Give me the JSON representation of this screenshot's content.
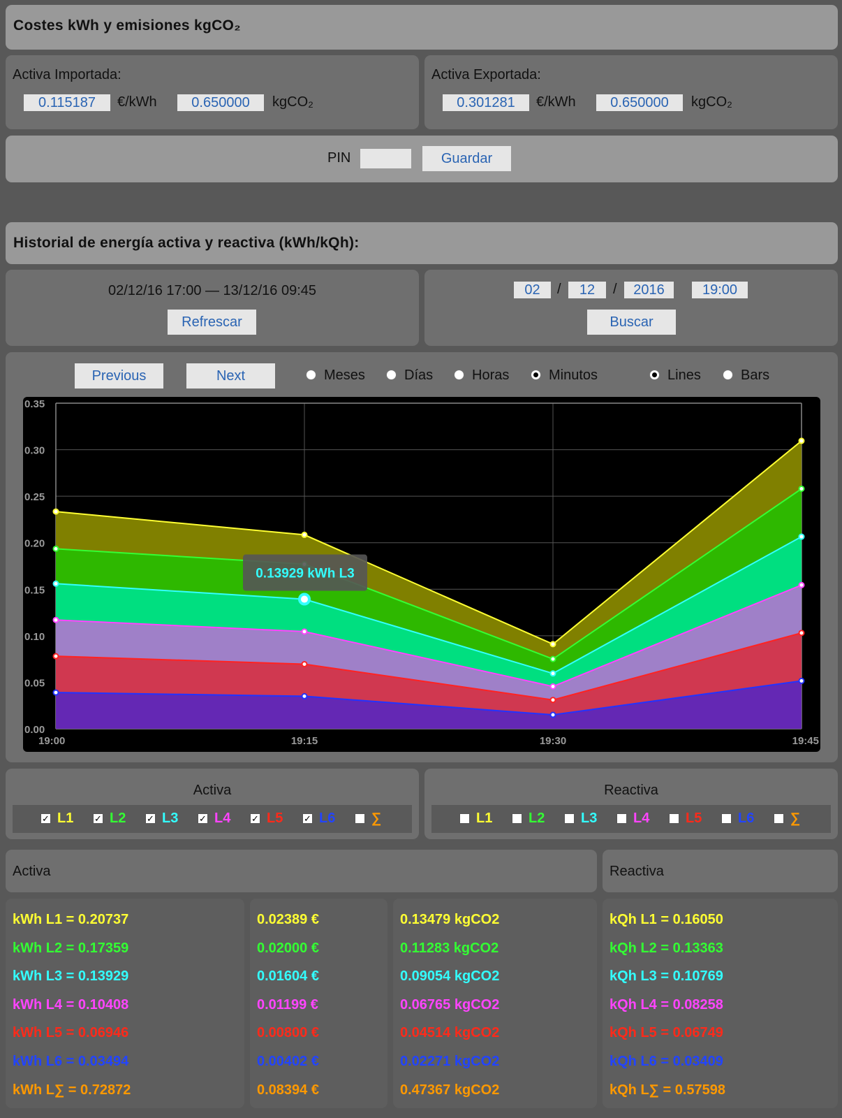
{
  "costs": {
    "title": "Costes kWh y emisiones kgCO₂",
    "import": {
      "label": "Activa Importada:",
      "price": "0.115187",
      "price_unit": "€/kWh",
      "co2": "0.650000",
      "co2_unit": "kgCO₂"
    },
    "export": {
      "label": "Activa Exportada:",
      "price": "0.301281",
      "price_unit": "€/kWh",
      "co2": "0.650000",
      "co2_unit": "kgCO₂"
    },
    "pin_label": "PIN",
    "pin_value": "",
    "save_label": "Guardar"
  },
  "history": {
    "title": "Historial de energía activa y reactiva (kWh/kQh):",
    "range": "02/12/16 17:00 — 13/12/16 09:45",
    "refresh_label": "Refrescar",
    "date": {
      "day": "02",
      "month": "12",
      "year": "2016",
      "time": "19:00",
      "sep": "/"
    },
    "search_label": "Buscar"
  },
  "controls": {
    "previous_label": "Previous",
    "next_label": "Next",
    "periods": [
      {
        "label": "Meses",
        "selected": false
      },
      {
        "label": "Días",
        "selected": false
      },
      {
        "label": "Horas",
        "selected": false
      },
      {
        "label": "Minutos",
        "selected": true
      }
    ],
    "modes": [
      {
        "label": "Lines",
        "selected": true
      },
      {
        "label": "Bars",
        "selected": false
      }
    ]
  },
  "chart_data": {
    "type": "area",
    "x": [
      "19:00",
      "19:15",
      "19:30",
      "19:45"
    ],
    "ylim": [
      0,
      0.35
    ],
    "yticks": [
      "0.00",
      "0.05",
      "0.10",
      "0.15",
      "0.20",
      "0.25",
      "0.30",
      "0.35"
    ],
    "grid": true,
    "stacked": true,
    "series": [
      {
        "name": "L1",
        "color": "#ffff33",
        "fill": "#808000",
        "cumulative": [
          0.2335,
          0.2085,
          0.091,
          0.3095
        ]
      },
      {
        "name": "L2",
        "color": "#33ff33",
        "fill": "#2eb800",
        "cumulative": [
          0.1935,
          0.177,
          0.075,
          0.258
        ]
      },
      {
        "name": "L3",
        "color": "#33ffff",
        "fill": "#00df80",
        "cumulative": [
          0.156,
          0.1393,
          0.0595,
          0.2065
        ]
      },
      {
        "name": "L4",
        "color": "#ff44ff",
        "fill": "#9f80c8",
        "cumulative": [
          0.117,
          0.1045,
          0.0455,
          0.1545
        ]
      },
      {
        "name": "L5",
        "color": "#ff2222",
        "fill": "#d03850",
        "cumulative": [
          0.078,
          0.0695,
          0.031,
          0.103
        ]
      },
      {
        "name": "L6",
        "color": "#2233ff",
        "fill": "#6428b4",
        "cumulative": [
          0.039,
          0.035,
          0.015,
          0.0515
        ]
      }
    ],
    "tooltip": {
      "text": "0.13929 kWh L3",
      "series": "L3",
      "x": "19:15",
      "value": 0.13929
    }
  },
  "legend_activa": {
    "title": "Activa",
    "items": [
      {
        "label": "L1",
        "checked": true,
        "color": "#ffff33"
      },
      {
        "label": "L2",
        "checked": true,
        "color": "#33ff33"
      },
      {
        "label": "L3",
        "checked": true,
        "color": "#33ffff"
      },
      {
        "label": "L4",
        "checked": true,
        "color": "#ff44ff"
      },
      {
        "label": "L5",
        "checked": true,
        "color": "#ff2a1a"
      },
      {
        "label": "L6",
        "checked": true,
        "color": "#2244ff"
      },
      {
        "label": "∑",
        "checked": false,
        "color": "#ff9900"
      }
    ]
  },
  "legend_reactiva": {
    "title": "Reactiva",
    "items": [
      {
        "label": "L1",
        "checked": false,
        "color": "#ffff33"
      },
      {
        "label": "L2",
        "checked": false,
        "color": "#33ff33"
      },
      {
        "label": "L3",
        "checked": false,
        "color": "#33ffff"
      },
      {
        "label": "L4",
        "checked": false,
        "color": "#ff44ff"
      },
      {
        "label": "L5",
        "checked": false,
        "color": "#ff2a1a"
      },
      {
        "label": "L6",
        "checked": false,
        "color": "#2244ff"
      },
      {
        "label": "∑",
        "checked": false,
        "color": "#ff9900"
      }
    ]
  },
  "summary": {
    "activa_title": "Activa",
    "reactiva_title": "Reactiva",
    "colors": [
      "#ffff33",
      "#33ff33",
      "#33ffff",
      "#ff44ff",
      "#ff2a1a",
      "#2244ff",
      "#ff9900"
    ],
    "kwh": [
      "kWh L1 = 0.20737",
      "kWh L2 = 0.17359",
      "kWh L3 = 0.13929",
      "kWh L4 = 0.10408",
      "kWh L5 = 0.06946",
      "kWh L6 = 0.03494",
      "kWh L∑ = 0.72872"
    ],
    "eur": [
      "0.02389 €",
      "0.02000 €",
      "0.01604 €",
      "0.01199 €",
      "0.00800 €",
      "0.00402 €",
      "0.08394 €"
    ],
    "co2": [
      "0.13479 kgCO2",
      "0.11283 kgCO2",
      "0.09054 kgCO2",
      "0.06765 kgCO2",
      "0.04514 kgCO2",
      "0.02271 kgCO2",
      "0.47367 kgCO2"
    ],
    "kqh": [
      "kQh L1 = 0.16050",
      "kQh L2 = 0.13363",
      "kQh L3 = 0.10769",
      "kQh L4 = 0.08258",
      "kQh L5 = 0.06749",
      "kQh L6 = 0.03409",
      "kQh L∑ = 0.57598"
    ]
  }
}
